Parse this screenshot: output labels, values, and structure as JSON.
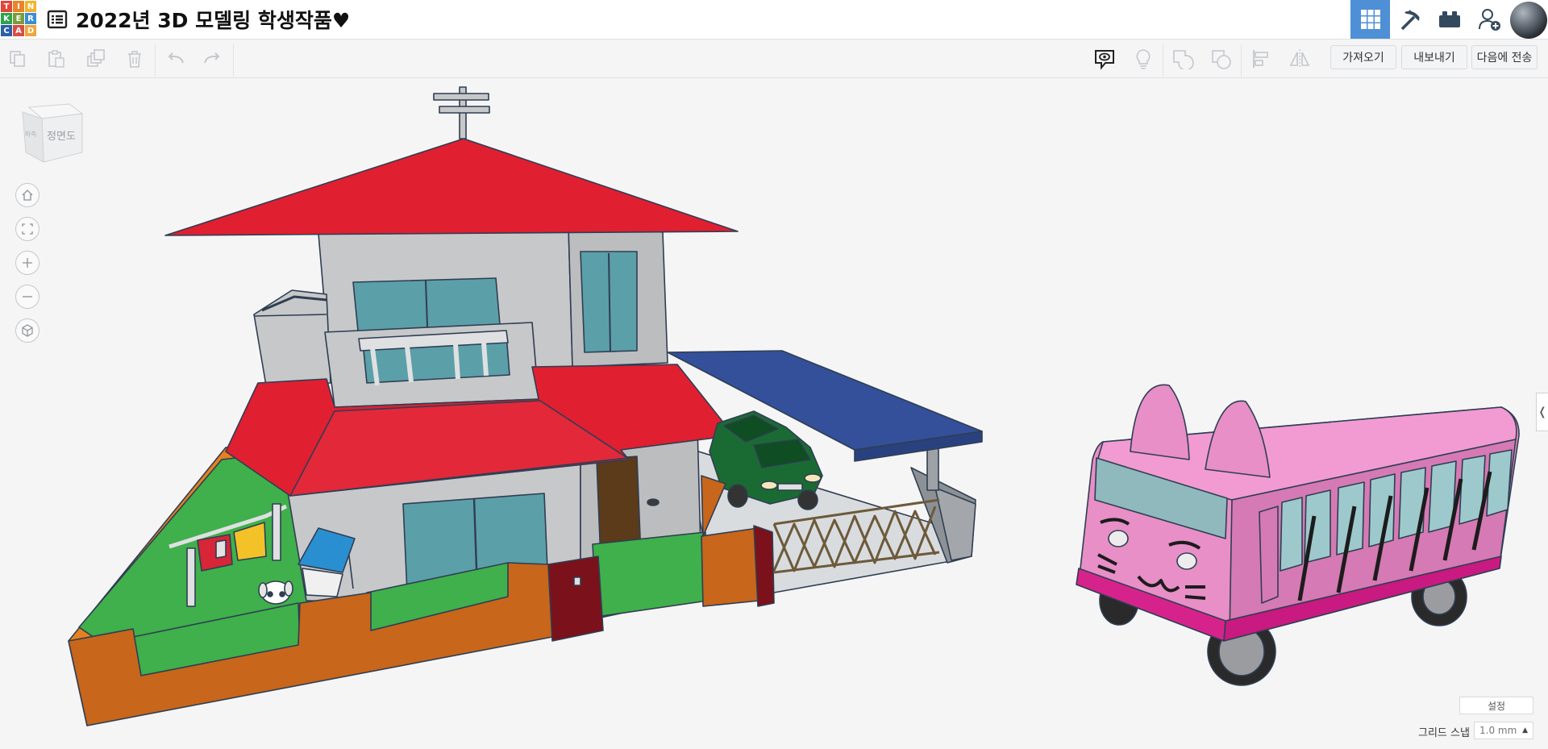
{
  "app": {
    "logo_letters": [
      "T",
      "I",
      "N",
      "K",
      "E",
      "R",
      "C",
      "A",
      "D"
    ],
    "logo_colors": [
      "#e3453a",
      "#e8842a",
      "#f1b42f",
      "#2fa34c",
      "#7a9c3a",
      "#3a8fd1",
      "#2c5fa8",
      "#d94c46",
      "#f0a63b"
    ],
    "design_title": "2022년 3D 모델링 학생작품♥"
  },
  "nav": {
    "items": [
      {
        "icon": "grid-view-icon",
        "active": true
      },
      {
        "icon": "pickaxe-icon",
        "active": false
      },
      {
        "icon": "bricks-icon",
        "active": false
      },
      {
        "icon": "add-user-icon",
        "active": false
      }
    ]
  },
  "toolbar": {
    "import_label": "가져오기",
    "export_label": "내보내기",
    "send_to_label": "다음에 전송"
  },
  "viewcube": {
    "face_label": "정면도",
    "side_label": "좌측"
  },
  "bottom": {
    "settings_label": "설정",
    "grid_snap_label": "그리드 스냅",
    "grid_snap_value": "1.0 mm"
  },
  "colors": {
    "accent": "#4e8fd6",
    "roof_red": "#e01f31",
    "wall_gray": "#c7c8ca",
    "window_teal": "#5b9fa9",
    "fence_orange": "#cc6a1c",
    "grass_green": "#3fb04b",
    "carport_blue": "#34509a",
    "bus_pink": "#e78fc6"
  }
}
